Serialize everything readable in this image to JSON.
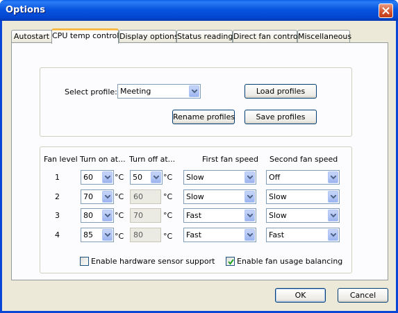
{
  "window": {
    "title": "Options",
    "close_label": "close"
  },
  "tabs": [
    {
      "label": "Autostart",
      "active": false
    },
    {
      "label": "CPU temp control",
      "active": true
    },
    {
      "label": "Display options",
      "active": false
    },
    {
      "label": "Status reading",
      "active": false
    },
    {
      "label": "Direct fan control",
      "active": false
    },
    {
      "label": "Miscellaneous",
      "active": false
    }
  ],
  "profile": {
    "label": "Select profile:",
    "selected": "Meeting",
    "load_label": "Load profiles",
    "rename_label": "Rename profiles",
    "save_label": "Save profiles"
  },
  "fan_table": {
    "headers": [
      "Fan level",
      "Turn on at...",
      "Turn off at...",
      "First fan speed",
      "Second fan speed"
    ],
    "unit": "°C",
    "rows": [
      {
        "level": "1",
        "turn_on": "60",
        "turn_off": "50",
        "first_speed": "Slow",
        "second_speed": "Off",
        "turn_off_editable": true
      },
      {
        "level": "2",
        "turn_on": "70",
        "turn_off": "60",
        "first_speed": "Slow",
        "second_speed": "Slow",
        "turn_off_editable": false
      },
      {
        "level": "3",
        "turn_on": "80",
        "turn_off": "70",
        "first_speed": "Fast",
        "second_speed": "Slow",
        "turn_off_editable": false
      },
      {
        "level": "4",
        "turn_on": "85",
        "turn_off": "80",
        "first_speed": "Fast",
        "second_speed": "Fast",
        "turn_off_editable": false
      }
    ]
  },
  "options": {
    "hardware_sensor_label": "Enable hardware sensor support",
    "hardware_sensor_checked": false,
    "fan_balancing_label": "Enable fan usage balancing",
    "fan_balancing_checked": true
  },
  "footer": {
    "ok_label": "OK",
    "cancel_label": "Cancel"
  },
  "colors": {
    "titlebar": "#0a46d6",
    "dialog_bg": "#ece9d8",
    "active_tab_highlight": "#f8b335",
    "button_border": "#003c74"
  }
}
